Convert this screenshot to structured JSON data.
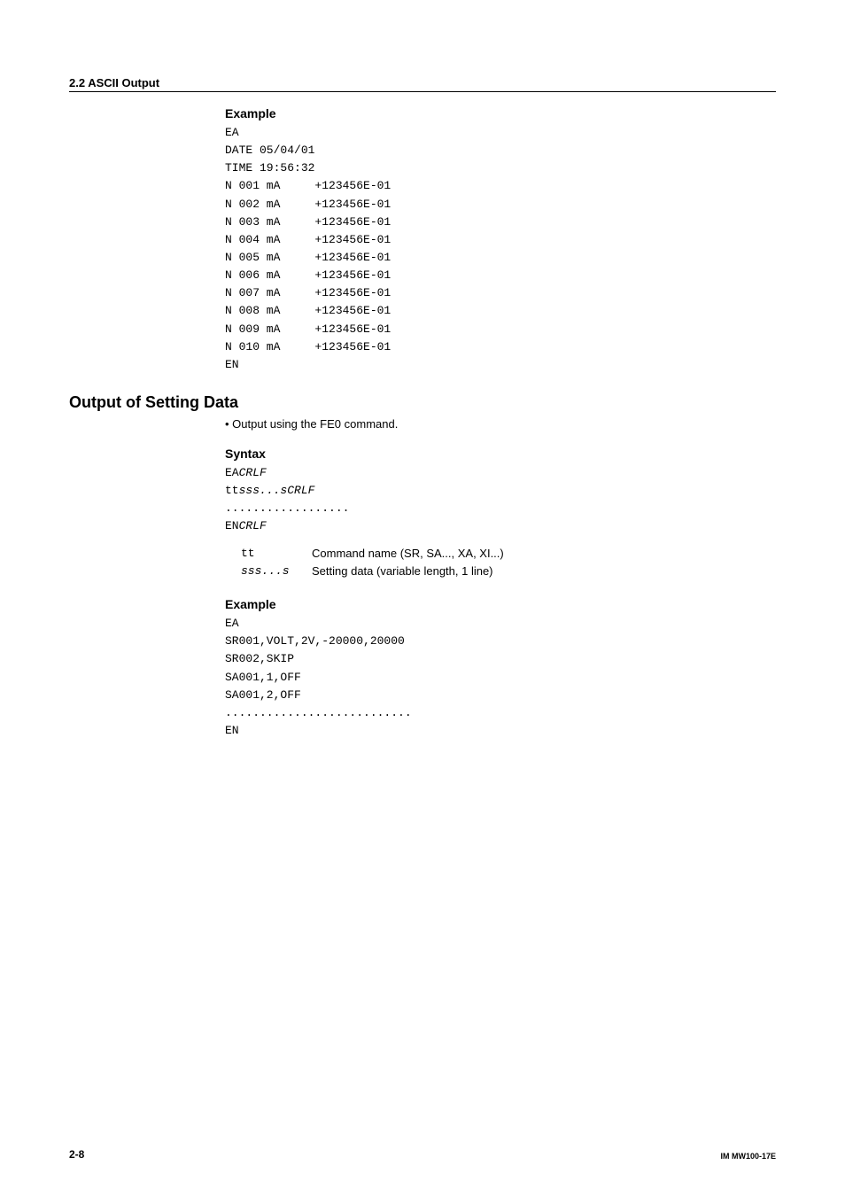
{
  "header": {
    "section": "2.2  ASCII Output"
  },
  "example1": {
    "title": "Example",
    "lines": [
      "EA",
      "DATE 05/04/01",
      "TIME 19:56:32",
      "N 001 mA     +123456E-01",
      "N 002 mA     +123456E-01",
      "N 003 mA     +123456E-01",
      "N 004 mA     +123456E-01",
      "N 005 mA     +123456E-01",
      "N 006 mA     +123456E-01",
      "N 007 mA     +123456E-01",
      "N 008 mA     +123456E-01",
      "N 009 mA     +123456E-01",
      "N 010 mA     +123456E-01",
      "EN"
    ]
  },
  "output_setting": {
    "heading": "Output of Setting Data",
    "bullet": "Output using the FE0 command."
  },
  "syntax": {
    "title": "Syntax",
    "l1a": "EA",
    "l1b": "CRLF",
    "l2a": "tt",
    "l2b": "sss...s",
    "l2c": "CRLF",
    "l3": "..................",
    "l4a": "EN",
    "l4b": "CRLF",
    "defs": [
      {
        "k": "tt",
        "v": "Command name (SR, SA..., XA, XI...)"
      },
      {
        "k": "sss...s",
        "v": "Setting data (variable length, 1 line)"
      }
    ]
  },
  "example2": {
    "title": "Example",
    "lines": [
      "EA",
      "SR001,VOLT,2V,-20000,20000",
      "SR002,SKIP",
      "SA001,1,OFF",
      "SA001,2,OFF",
      "...........................",
      "EN"
    ]
  },
  "footer": {
    "left": "2-8",
    "right": "IM MW100-17E"
  }
}
